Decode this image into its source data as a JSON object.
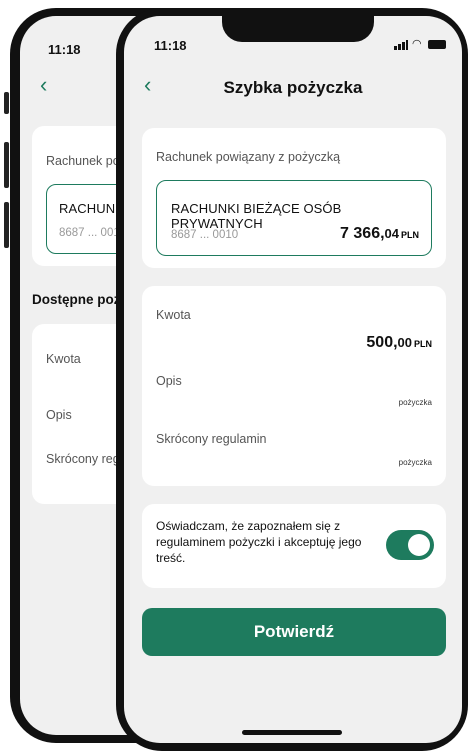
{
  "status": {
    "time_back": "11:18",
    "time_front": "11:18"
  },
  "back_phone": {
    "linked_account_label": "Rachunek po",
    "account_name": "RACHUNK",
    "account_number": "8687 ... 001",
    "section_title": "Dostępne poż",
    "amount_label": "Kwota",
    "description_label": "Opis",
    "terms_label": "Skrócony reg"
  },
  "header": {
    "title": "Szybka pożyczka"
  },
  "account_card": {
    "label": "Rachunek powiązany z pożyczką",
    "account_name": "RACHUNKI BIEŻĄCE OSÓB PRYWATNYCH",
    "account_number": "8687 ... 0010",
    "balance_main": "7 366,",
    "balance_decimal": "04",
    "balance_unit": "PLN"
  },
  "loan_card": {
    "amount_label": "Kwota",
    "amount_main": "500,",
    "amount_decimal": "00",
    "amount_unit": "PLN",
    "description_label": "Opis",
    "description_value": "pożyczka",
    "terms_label": "Skrócony regulamin",
    "terms_value": "pożyczka"
  },
  "consent": {
    "text": "Oświadczam, że zapoznałem się z regulaminem pożyczki i akceptuję jego treść.",
    "toggle_on": true
  },
  "confirm_button": {
    "label": "Potwierdź"
  },
  "colors": {
    "accent": "#1e7b5e",
    "background": "#f0f0f0",
    "card": "#ffffff"
  }
}
